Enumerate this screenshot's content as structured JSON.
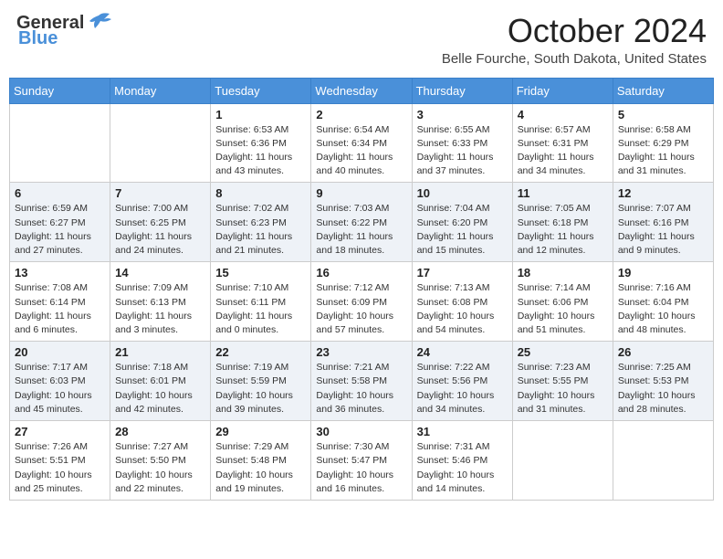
{
  "header": {
    "logo_line1": "General",
    "logo_line2": "Blue",
    "month": "October 2024",
    "location": "Belle Fourche, South Dakota, United States"
  },
  "days_of_week": [
    "Sunday",
    "Monday",
    "Tuesday",
    "Wednesday",
    "Thursday",
    "Friday",
    "Saturday"
  ],
  "weeks": [
    [
      {
        "day": "",
        "sunrise": "",
        "sunset": "",
        "daylight": ""
      },
      {
        "day": "",
        "sunrise": "",
        "sunset": "",
        "daylight": ""
      },
      {
        "day": "1",
        "sunrise": "Sunrise: 6:53 AM",
        "sunset": "Sunset: 6:36 PM",
        "daylight": "Daylight: 11 hours and 43 minutes."
      },
      {
        "day": "2",
        "sunrise": "Sunrise: 6:54 AM",
        "sunset": "Sunset: 6:34 PM",
        "daylight": "Daylight: 11 hours and 40 minutes."
      },
      {
        "day": "3",
        "sunrise": "Sunrise: 6:55 AM",
        "sunset": "Sunset: 6:33 PM",
        "daylight": "Daylight: 11 hours and 37 minutes."
      },
      {
        "day": "4",
        "sunrise": "Sunrise: 6:57 AM",
        "sunset": "Sunset: 6:31 PM",
        "daylight": "Daylight: 11 hours and 34 minutes."
      },
      {
        "day": "5",
        "sunrise": "Sunrise: 6:58 AM",
        "sunset": "Sunset: 6:29 PM",
        "daylight": "Daylight: 11 hours and 31 minutes."
      }
    ],
    [
      {
        "day": "6",
        "sunrise": "Sunrise: 6:59 AM",
        "sunset": "Sunset: 6:27 PM",
        "daylight": "Daylight: 11 hours and 27 minutes."
      },
      {
        "day": "7",
        "sunrise": "Sunrise: 7:00 AM",
        "sunset": "Sunset: 6:25 PM",
        "daylight": "Daylight: 11 hours and 24 minutes."
      },
      {
        "day": "8",
        "sunrise": "Sunrise: 7:02 AM",
        "sunset": "Sunset: 6:23 PM",
        "daylight": "Daylight: 11 hours and 21 minutes."
      },
      {
        "day": "9",
        "sunrise": "Sunrise: 7:03 AM",
        "sunset": "Sunset: 6:22 PM",
        "daylight": "Daylight: 11 hours and 18 minutes."
      },
      {
        "day": "10",
        "sunrise": "Sunrise: 7:04 AM",
        "sunset": "Sunset: 6:20 PM",
        "daylight": "Daylight: 11 hours and 15 minutes."
      },
      {
        "day": "11",
        "sunrise": "Sunrise: 7:05 AM",
        "sunset": "Sunset: 6:18 PM",
        "daylight": "Daylight: 11 hours and 12 minutes."
      },
      {
        "day": "12",
        "sunrise": "Sunrise: 7:07 AM",
        "sunset": "Sunset: 6:16 PM",
        "daylight": "Daylight: 11 hours and 9 minutes."
      }
    ],
    [
      {
        "day": "13",
        "sunrise": "Sunrise: 7:08 AM",
        "sunset": "Sunset: 6:14 PM",
        "daylight": "Daylight: 11 hours and 6 minutes."
      },
      {
        "day": "14",
        "sunrise": "Sunrise: 7:09 AM",
        "sunset": "Sunset: 6:13 PM",
        "daylight": "Daylight: 11 hours and 3 minutes."
      },
      {
        "day": "15",
        "sunrise": "Sunrise: 7:10 AM",
        "sunset": "Sunset: 6:11 PM",
        "daylight": "Daylight: 11 hours and 0 minutes."
      },
      {
        "day": "16",
        "sunrise": "Sunrise: 7:12 AM",
        "sunset": "Sunset: 6:09 PM",
        "daylight": "Daylight: 10 hours and 57 minutes."
      },
      {
        "day": "17",
        "sunrise": "Sunrise: 7:13 AM",
        "sunset": "Sunset: 6:08 PM",
        "daylight": "Daylight: 10 hours and 54 minutes."
      },
      {
        "day": "18",
        "sunrise": "Sunrise: 7:14 AM",
        "sunset": "Sunset: 6:06 PM",
        "daylight": "Daylight: 10 hours and 51 minutes."
      },
      {
        "day": "19",
        "sunrise": "Sunrise: 7:16 AM",
        "sunset": "Sunset: 6:04 PM",
        "daylight": "Daylight: 10 hours and 48 minutes."
      }
    ],
    [
      {
        "day": "20",
        "sunrise": "Sunrise: 7:17 AM",
        "sunset": "Sunset: 6:03 PM",
        "daylight": "Daylight: 10 hours and 45 minutes."
      },
      {
        "day": "21",
        "sunrise": "Sunrise: 7:18 AM",
        "sunset": "Sunset: 6:01 PM",
        "daylight": "Daylight: 10 hours and 42 minutes."
      },
      {
        "day": "22",
        "sunrise": "Sunrise: 7:19 AM",
        "sunset": "Sunset: 5:59 PM",
        "daylight": "Daylight: 10 hours and 39 minutes."
      },
      {
        "day": "23",
        "sunrise": "Sunrise: 7:21 AM",
        "sunset": "Sunset: 5:58 PM",
        "daylight": "Daylight: 10 hours and 36 minutes."
      },
      {
        "day": "24",
        "sunrise": "Sunrise: 7:22 AM",
        "sunset": "Sunset: 5:56 PM",
        "daylight": "Daylight: 10 hours and 34 minutes."
      },
      {
        "day": "25",
        "sunrise": "Sunrise: 7:23 AM",
        "sunset": "Sunset: 5:55 PM",
        "daylight": "Daylight: 10 hours and 31 minutes."
      },
      {
        "day": "26",
        "sunrise": "Sunrise: 7:25 AM",
        "sunset": "Sunset: 5:53 PM",
        "daylight": "Daylight: 10 hours and 28 minutes."
      }
    ],
    [
      {
        "day": "27",
        "sunrise": "Sunrise: 7:26 AM",
        "sunset": "Sunset: 5:51 PM",
        "daylight": "Daylight: 10 hours and 25 minutes."
      },
      {
        "day": "28",
        "sunrise": "Sunrise: 7:27 AM",
        "sunset": "Sunset: 5:50 PM",
        "daylight": "Daylight: 10 hours and 22 minutes."
      },
      {
        "day": "29",
        "sunrise": "Sunrise: 7:29 AM",
        "sunset": "Sunset: 5:48 PM",
        "daylight": "Daylight: 10 hours and 19 minutes."
      },
      {
        "day": "30",
        "sunrise": "Sunrise: 7:30 AM",
        "sunset": "Sunset: 5:47 PM",
        "daylight": "Daylight: 10 hours and 16 minutes."
      },
      {
        "day": "31",
        "sunrise": "Sunrise: 7:31 AM",
        "sunset": "Sunset: 5:46 PM",
        "daylight": "Daylight: 10 hours and 14 minutes."
      },
      {
        "day": "",
        "sunrise": "",
        "sunset": "",
        "daylight": ""
      },
      {
        "day": "",
        "sunrise": "",
        "sunset": "",
        "daylight": ""
      }
    ]
  ],
  "colors": {
    "header_bg": "#4a90d9",
    "header_text": "#ffffff",
    "even_row_bg": "#eef2f7",
    "odd_row_bg": "#ffffff"
  }
}
